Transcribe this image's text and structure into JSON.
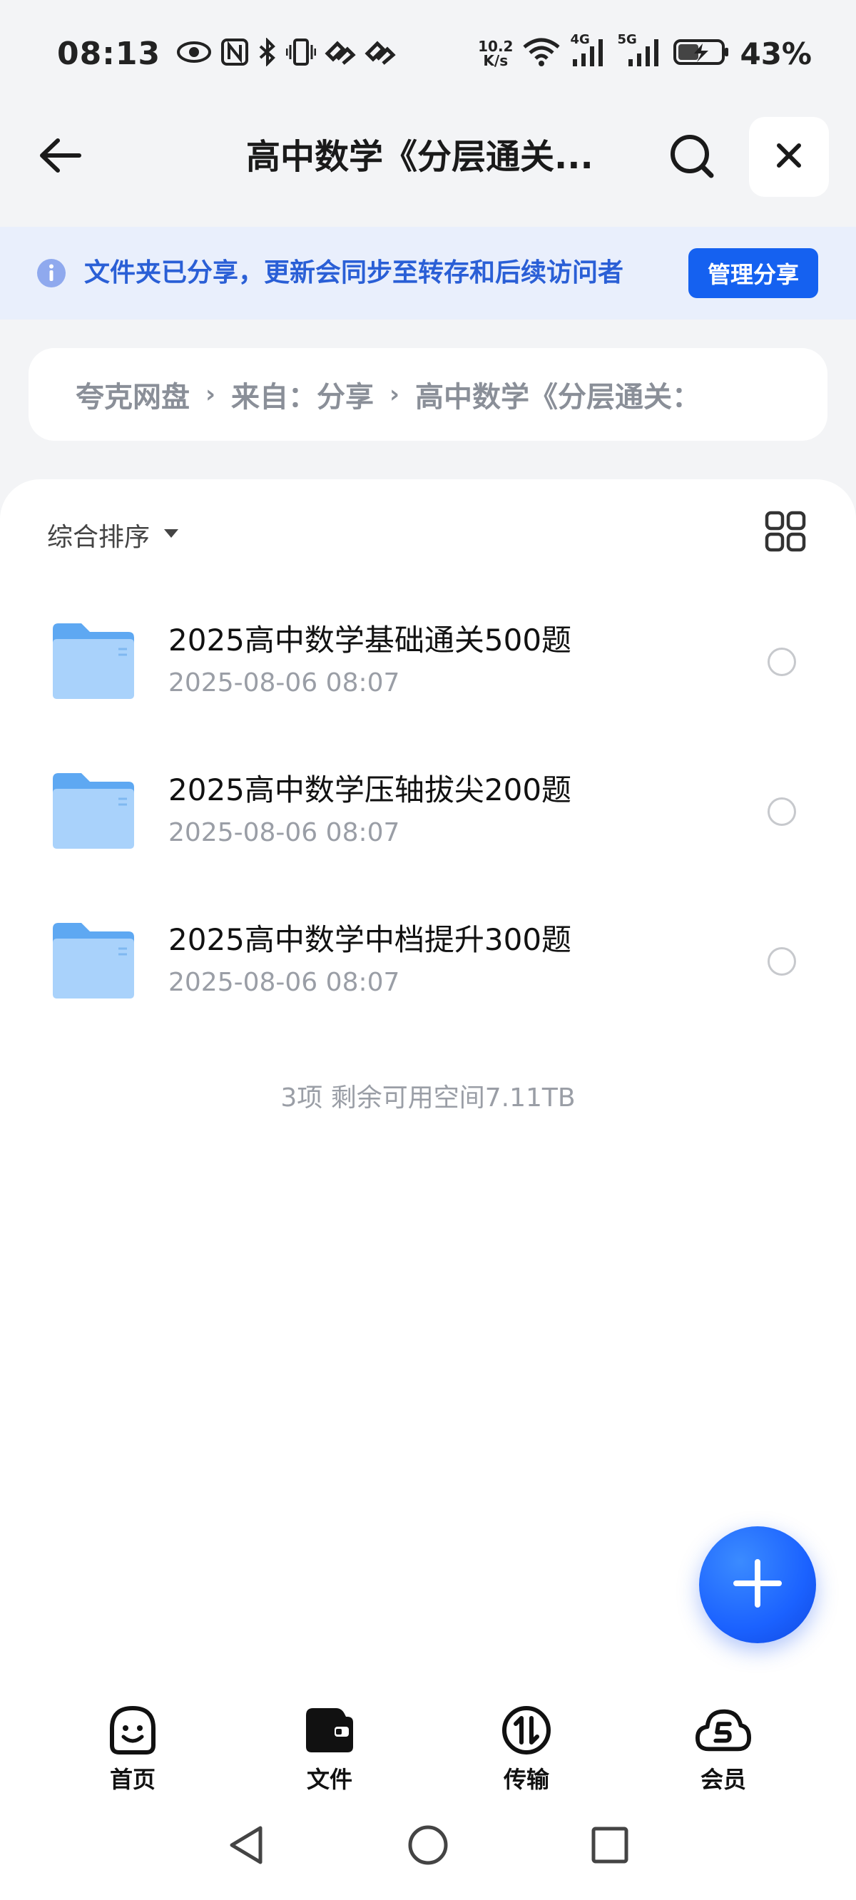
{
  "status_bar": {
    "time": "08:13",
    "net_speed_value": "10.2",
    "net_speed_unit": "K/s",
    "signal_1_label": "4G",
    "signal_2_label": "5G",
    "battery_percent": "43%",
    "icons": [
      "eye-icon",
      "nfc-icon",
      "bluetooth-icon",
      "vibrate-icon",
      "link-icon",
      "link-icon",
      "wifi-icon",
      "signal-icon",
      "battery-charging-icon"
    ]
  },
  "header": {
    "title": "高中数学《分层通关...",
    "icons": [
      "back-arrow-icon",
      "search-icon",
      "close-icon"
    ]
  },
  "share_banner": {
    "message": "文件夹已分享，更新会同步至转存和后续访问者",
    "button_label": "管理分享"
  },
  "breadcrumb": {
    "items": [
      "夸克网盘",
      "来自：分享",
      "高中数学《分层通关："
    ]
  },
  "toolbar": {
    "sort_label": "综合排序"
  },
  "files": [
    {
      "name": "2025高中数学基础通关500题",
      "date": "2025-08-06 08:07"
    },
    {
      "name": "2025高中数学压轴拔尖200题",
      "date": "2025-08-06 08:07"
    },
    {
      "name": "2025高中数学中档提升300题",
      "date": "2025-08-06 08:07"
    }
  ],
  "summary": "3项 剩余可用空间7.11TB",
  "bottom_nav": {
    "items": [
      {
        "label": "首页",
        "icon": "smiley-home-icon"
      },
      {
        "label": "文件",
        "icon": "folder-wallet-icon"
      },
      {
        "label": "传输",
        "icon": "transfer-icon"
      },
      {
        "label": "会员",
        "icon": "vip-cloud-icon"
      }
    ]
  },
  "colors": {
    "accent": "#1561f0",
    "banner_bg": "#e9effc",
    "banner_text": "#2a5fd6",
    "folder": "#6fb6f8",
    "background": "#f3f4f6"
  }
}
